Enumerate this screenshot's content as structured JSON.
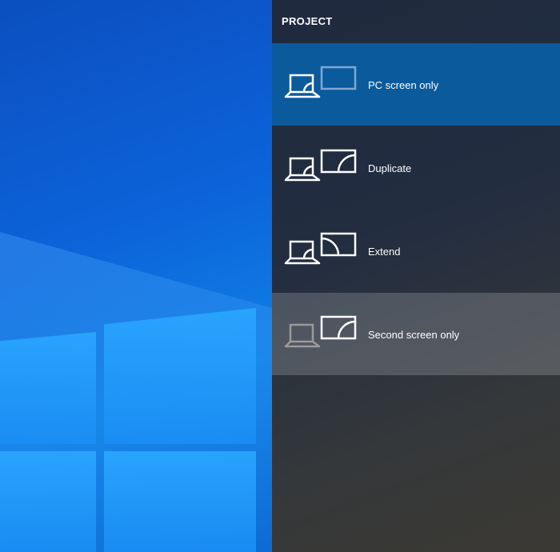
{
  "panel": {
    "title": "PROJECT",
    "items": [
      {
        "label": "PC screen only",
        "icon": "pc-screen-only-icon",
        "state": "selected"
      },
      {
        "label": "Duplicate",
        "icon": "duplicate-icon",
        "state": "normal"
      },
      {
        "label": "Extend",
        "icon": "extend-icon",
        "state": "normal"
      },
      {
        "label": "Second screen only",
        "icon": "second-screen-only-icon",
        "state": "hover"
      }
    ]
  },
  "colors": {
    "selected": "#0b5a9c",
    "panel": "#222d40",
    "desktop": "#0c62d8"
  }
}
